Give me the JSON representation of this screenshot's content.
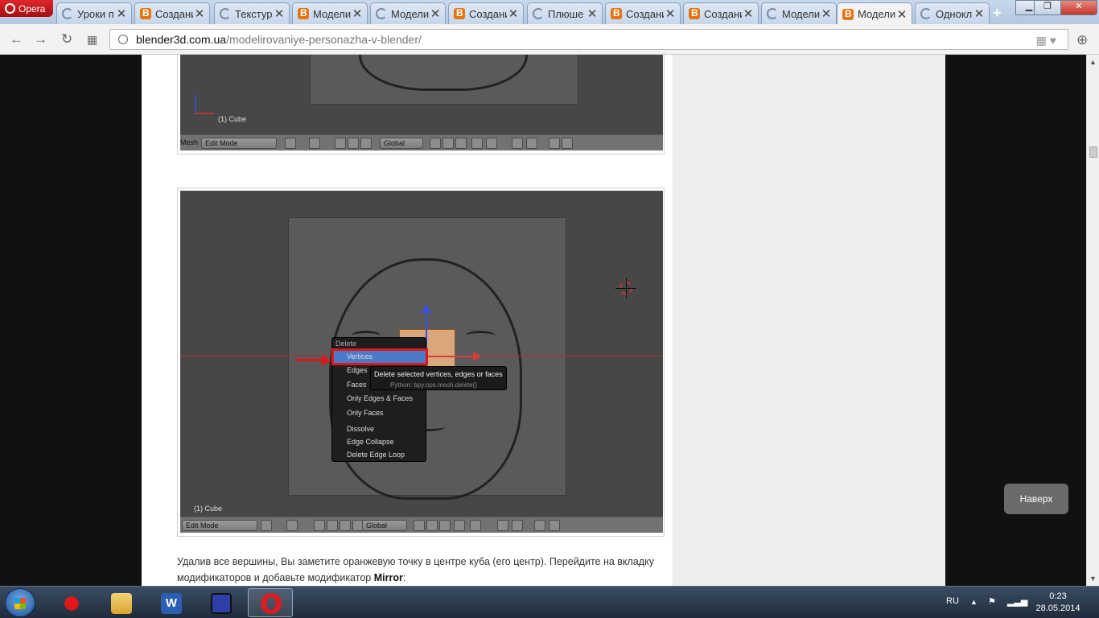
{
  "browser": {
    "menu_label": "Opera",
    "tabs": [
      {
        "title": "Уроки п",
        "icon": "loading-icon"
      },
      {
        "title": "Создани",
        "icon": "blender-icon"
      },
      {
        "title": "Текстур",
        "icon": "loading-icon"
      },
      {
        "title": "Модели",
        "icon": "blender-icon"
      },
      {
        "title": "Модели",
        "icon": "loading-icon"
      },
      {
        "title": "Создани",
        "icon": "blender-icon"
      },
      {
        "title": "Плюше",
        "icon": "loading-icon"
      },
      {
        "title": "Создани",
        "icon": "blender-icon"
      },
      {
        "title": "Создани",
        "icon": "blender-icon"
      },
      {
        "title": "Модели",
        "icon": "loading-icon"
      },
      {
        "title": "Модели",
        "icon": "blender-icon",
        "active": true
      },
      {
        "title": "Однокл",
        "icon": "loading-icon"
      }
    ],
    "close_glyph": "✕",
    "new_tab_glyph": "+",
    "url_host": "blender3d.com.ua",
    "url_path": "/modelirovaniye-personazha-v-blender/"
  },
  "screenshot_top": {
    "label": "(1) Cube",
    "mesh_label": "Mesh",
    "mode": "Edit Mode",
    "orientation": "Global"
  },
  "screenshot_main": {
    "label": "(1) Cube",
    "mode": "Edit Mode",
    "orientation": "Global",
    "menu": {
      "title": "Delete",
      "items": [
        "Vertices",
        "Edges",
        "Faces",
        "Only Edges & Faces",
        "Only Faces",
        "Dissolve",
        "Edge Collapse",
        "Delete Edge Loop"
      ]
    },
    "tooltip": {
      "line1": "Delete selected vertices, edges or faces",
      "line2": "Python: bpy.ops.mesh.delete()"
    }
  },
  "article": {
    "text_part1": "Удалив все вершины, Вы заметите оранжевую точку в центре куба (его центр). Перейдите на вкладку модификаторов и добавьте модификатор ",
    "text_bold": "Mirror",
    "text_part2": ":"
  },
  "scroll_top_label": "Наверх",
  "taskbar": {
    "language": "RU",
    "time": "0:23",
    "date": "28.05.2014"
  },
  "colors": {
    "blender_orange": "#e8740f",
    "menu_highlight": "#4d7ac8",
    "annotation_red": "#e0161a"
  }
}
